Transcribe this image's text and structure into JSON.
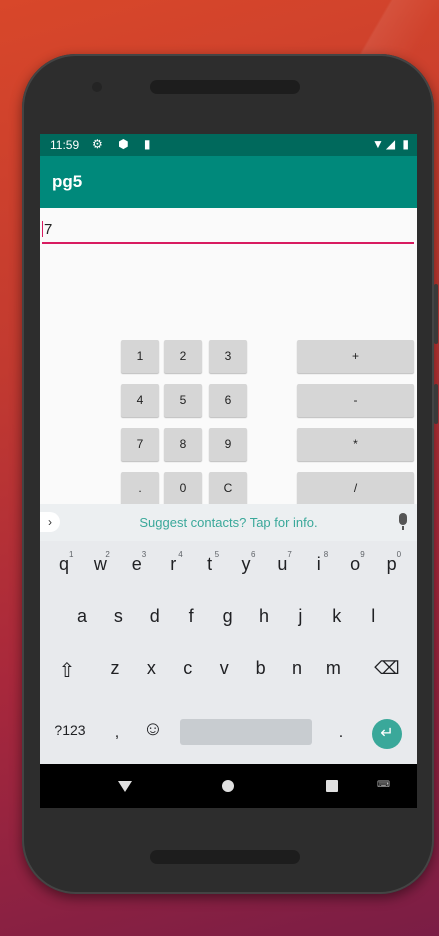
{
  "status_bar": {
    "time": "11:59",
    "left_icons": "⚙ ⬢ ▮",
    "right_icons": "▼◢ ▮"
  },
  "app": {
    "title": "pg5"
  },
  "input": {
    "value": "7"
  },
  "calculator": {
    "numbers": [
      [
        "1",
        "2",
        "3"
      ],
      [
        "4",
        "5",
        "6"
      ],
      [
        "7",
        "8",
        "9"
      ],
      [
        ".",
        "0",
        "C"
      ]
    ],
    "operators": [
      "+",
      "-",
      "*",
      "/"
    ]
  },
  "keyboard": {
    "suggestion": "Suggest contacts? Tap for info.",
    "row1": [
      "q",
      "w",
      "e",
      "r",
      "t",
      "y",
      "u",
      "i",
      "o",
      "p"
    ],
    "row1_hints": [
      "1",
      "2",
      "3",
      "4",
      "5",
      "6",
      "7",
      "8",
      "9",
      "0"
    ],
    "row2": [
      "a",
      "s",
      "d",
      "f",
      "g",
      "h",
      "j",
      "k",
      "l"
    ],
    "row3": [
      "z",
      "x",
      "c",
      "v",
      "b",
      "n",
      "m"
    ],
    "shift": "⇧",
    "backspace": "⌫",
    "symbols": "?123",
    "comma": ",",
    "emoji": "☺",
    "period": ".",
    "enter": "↵"
  },
  "nav": {
    "keyboard_icon": "⌨"
  }
}
